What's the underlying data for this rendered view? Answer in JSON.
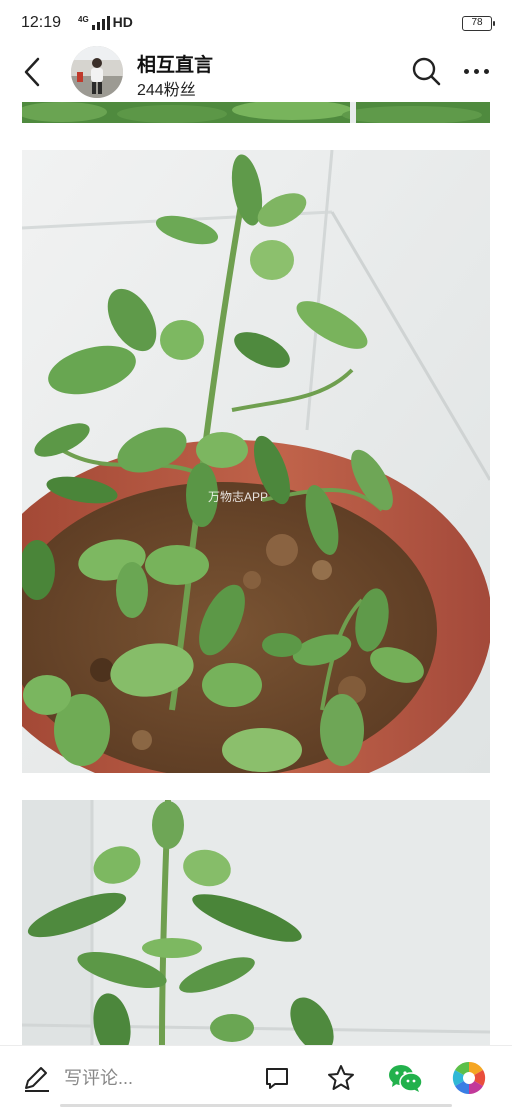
{
  "status_bar": {
    "time": "12:19",
    "network": "HD",
    "network_gen": "4G",
    "battery": "78"
  },
  "header": {
    "author_name": "相互直言",
    "followers": "244粉丝"
  },
  "article": {
    "watermark": "万物志APP"
  },
  "bottom_bar": {
    "comment_placeholder": "写评论..."
  },
  "colors": {
    "leaf_green": "#5f9a4a",
    "pot_terracotta": "#b4533d",
    "soil_brown": "#6e4a2c",
    "wall_white": "#e9ecec",
    "wechat_green": "#22b14c"
  }
}
